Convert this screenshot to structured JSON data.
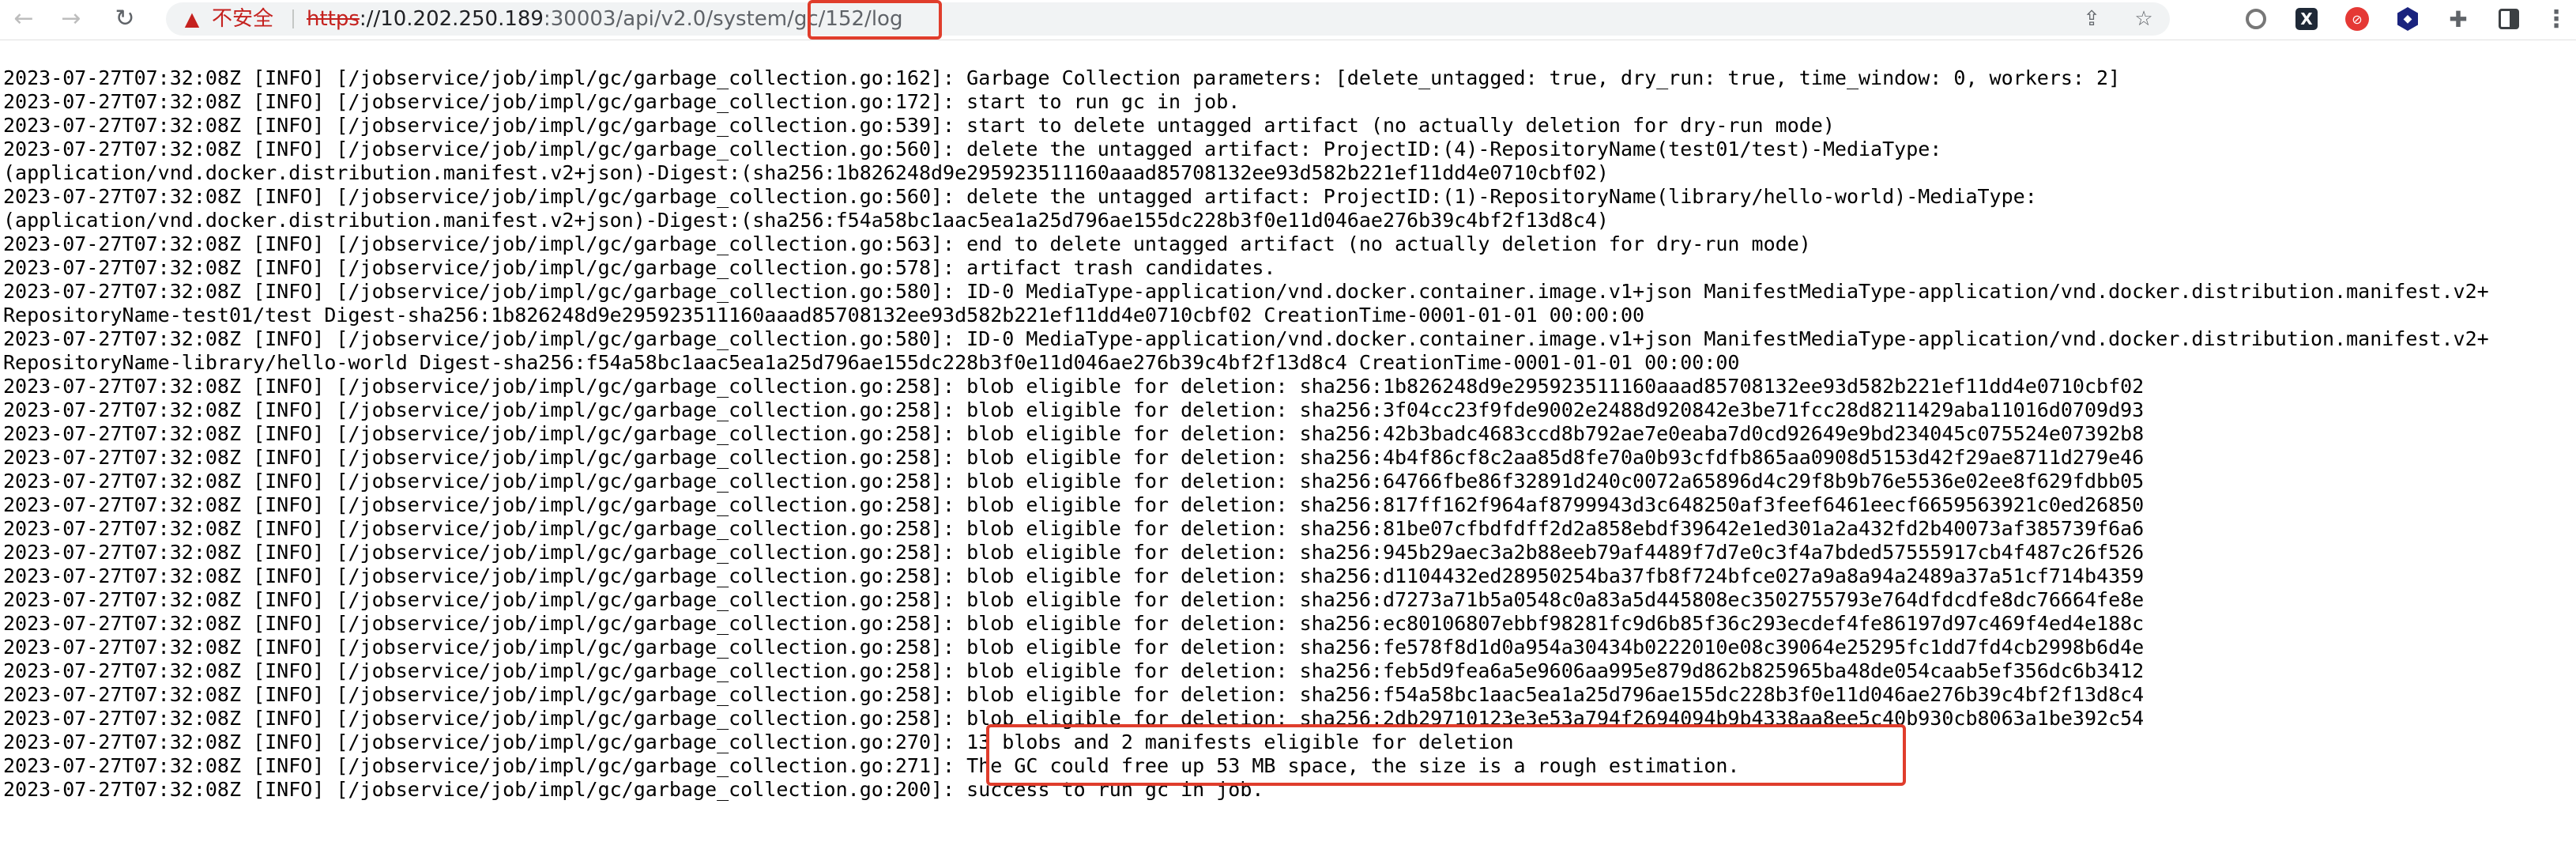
{
  "browser": {
    "insecure_label": "不安全",
    "url_scheme": "https",
    "url_host": "://10.202.250.189",
    "url_path": ":30003/api/v2.0/system/gc/152/log",
    "icons": {
      "back": "arrow-left-icon",
      "forward": "arrow-right-icon",
      "reload": "reload-icon",
      "warning": "warning-triangle-icon",
      "share": "share-icon",
      "bookmark": "star-icon",
      "extensions": "puzzle-icon",
      "side_panel": "side-panel-icon",
      "menu": "kebab-menu-icon"
    }
  },
  "log_lines": [
    "2023-07-27T07:32:08Z [INFO] [/jobservice/job/impl/gc/garbage_collection.go:162]: Garbage Collection parameters: [delete_untagged: true, dry_run: true, time_window: 0, workers: 2]",
    "2023-07-27T07:32:08Z [INFO] [/jobservice/job/impl/gc/garbage_collection.go:172]: start to run gc in job.",
    "2023-07-27T07:32:08Z [INFO] [/jobservice/job/impl/gc/garbage_collection.go:539]: start to delete untagged artifact (no actually deletion for dry-run mode)",
    "2023-07-27T07:32:08Z [INFO] [/jobservice/job/impl/gc/garbage_collection.go:560]: delete the untagged artifact: ProjectID:(4)-RepositoryName(test01/test)-MediaType:",
    "(application/vnd.docker.distribution.manifest.v2+json)-Digest:(sha256:1b826248d9e295923511160aaad85708132ee93d582b221ef11dd4e0710cbf02)",
    "2023-07-27T07:32:08Z [INFO] [/jobservice/job/impl/gc/garbage_collection.go:560]: delete the untagged artifact: ProjectID:(1)-RepositoryName(library/hello-world)-MediaType:",
    "(application/vnd.docker.distribution.manifest.v2+json)-Digest:(sha256:f54a58bc1aac5ea1a25d796ae155dc228b3f0e11d046ae276b39c4bf2f13d8c4)",
    "2023-07-27T07:32:08Z [INFO] [/jobservice/job/impl/gc/garbage_collection.go:563]: end to delete untagged artifact (no actually deletion for dry-run mode)",
    "2023-07-27T07:32:08Z [INFO] [/jobservice/job/impl/gc/garbage_collection.go:578]: artifact trash candidates.",
    "2023-07-27T07:32:08Z [INFO] [/jobservice/job/impl/gc/garbage_collection.go:580]: ID-0 MediaType-application/vnd.docker.container.image.v1+json ManifestMediaType-application/vnd.docker.distribution.manifest.v2+",
    "RepositoryName-test01/test Digest-sha256:1b826248d9e295923511160aaad85708132ee93d582b221ef11dd4e0710cbf02 CreationTime-0001-01-01 00:00:00",
    "2023-07-27T07:32:08Z [INFO] [/jobservice/job/impl/gc/garbage_collection.go:580]: ID-0 MediaType-application/vnd.docker.container.image.v1+json ManifestMediaType-application/vnd.docker.distribution.manifest.v2+",
    "RepositoryName-library/hello-world Digest-sha256:f54a58bc1aac5ea1a25d796ae155dc228b3f0e11d046ae276b39c4bf2f13d8c4 CreationTime-0001-01-01 00:00:00",
    "2023-07-27T07:32:08Z [INFO] [/jobservice/job/impl/gc/garbage_collection.go:258]: blob eligible for deletion: sha256:1b826248d9e295923511160aaad85708132ee93d582b221ef11dd4e0710cbf02",
    "2023-07-27T07:32:08Z [INFO] [/jobservice/job/impl/gc/garbage_collection.go:258]: blob eligible for deletion: sha256:3f04cc23f9fde9002e2488d920842e3be71fcc28d8211429aba11016d0709d93",
    "2023-07-27T07:32:08Z [INFO] [/jobservice/job/impl/gc/garbage_collection.go:258]: blob eligible for deletion: sha256:42b3badc4683ccd8b792ae7e0eaba7d0cd92649e9bd234045c075524e07392b8",
    "2023-07-27T07:32:08Z [INFO] [/jobservice/job/impl/gc/garbage_collection.go:258]: blob eligible for deletion: sha256:4b4f86cf8c2aa85d8fe70a0b93cfdfb865aa0908d5153d42f29ae8711d279e46",
    "2023-07-27T07:32:08Z [INFO] [/jobservice/job/impl/gc/garbage_collection.go:258]: blob eligible for deletion: sha256:64766fbe86f32891d240c0072a65896d4c29f8b9b76e5536e02ee8f629fdbb05",
    "2023-07-27T07:32:08Z [INFO] [/jobservice/job/impl/gc/garbage_collection.go:258]: blob eligible for deletion: sha256:817ff162f964af8799943d3c648250af3feef6461eecf6659563921c0ed26850",
    "2023-07-27T07:32:08Z [INFO] [/jobservice/job/impl/gc/garbage_collection.go:258]: blob eligible for deletion: sha256:81be07cfbdfdff2d2a858ebdf39642e1ed301a2a432fd2b40073af385739f6a6",
    "2023-07-27T07:32:08Z [INFO] [/jobservice/job/impl/gc/garbage_collection.go:258]: blob eligible for deletion: sha256:945b29aec3a2b88eeb79af4489f7d7e0c3f4a7bded57555917cb4f487c26f526",
    "2023-07-27T07:32:08Z [INFO] [/jobservice/job/impl/gc/garbage_collection.go:258]: blob eligible for deletion: sha256:d1104432ed28950254ba37fb8f724bfce027a9a8a94a2489a37a51cf714b4359",
    "2023-07-27T07:32:08Z [INFO] [/jobservice/job/impl/gc/garbage_collection.go:258]: blob eligible for deletion: sha256:d7273a71b5a0548c0a83a5d445808ec3502755793e764dfdcdfe8dc76664fe8e",
    "2023-07-27T07:32:08Z [INFO] [/jobservice/job/impl/gc/garbage_collection.go:258]: blob eligible for deletion: sha256:ec80106807ebbf98281fc9d6b85f36c293ecdef4fe86197d97c469f4ed4e188c",
    "2023-07-27T07:32:08Z [INFO] [/jobservice/job/impl/gc/garbage_collection.go:258]: blob eligible for deletion: sha256:fe578f8d1d0a954a30434b0222010e08c39064e25295fc1dd7fd4cb2998b6d4e",
    "2023-07-27T07:32:08Z [INFO] [/jobservice/job/impl/gc/garbage_collection.go:258]: blob eligible for deletion: sha256:feb5d9fea6a5e9606aa995e879d862b825965ba48de054caab5ef356dc6b3412",
    "2023-07-27T07:32:08Z [INFO] [/jobservice/job/impl/gc/garbage_collection.go:258]: blob eligible for deletion: sha256:f54a58bc1aac5ea1a25d796ae155dc228b3f0e11d046ae276b39c4bf2f13d8c4",
    "2023-07-27T07:32:08Z [INFO] [/jobservice/job/impl/gc/garbage_collection.go:258]: blob eligible for deletion: sha256:2db29710123e3e53a794f2694094b9b4338aa8ee5c40b930cb8063a1be392c54",
    "2023-07-27T07:32:08Z [INFO] [/jobservice/job/impl/gc/garbage_collection.go:270]: 13 blobs and 2 manifests eligible for deletion",
    "2023-07-27T07:32:08Z [INFO] [/jobservice/job/impl/gc/garbage_collection.go:271]: The GC could free up 53 MB space, the size is a rough estimation.",
    "2023-07-27T07:32:08Z [INFO] [/jobservice/job/impl/gc/garbage_collection.go:200]: success to run gc in job."
  ]
}
